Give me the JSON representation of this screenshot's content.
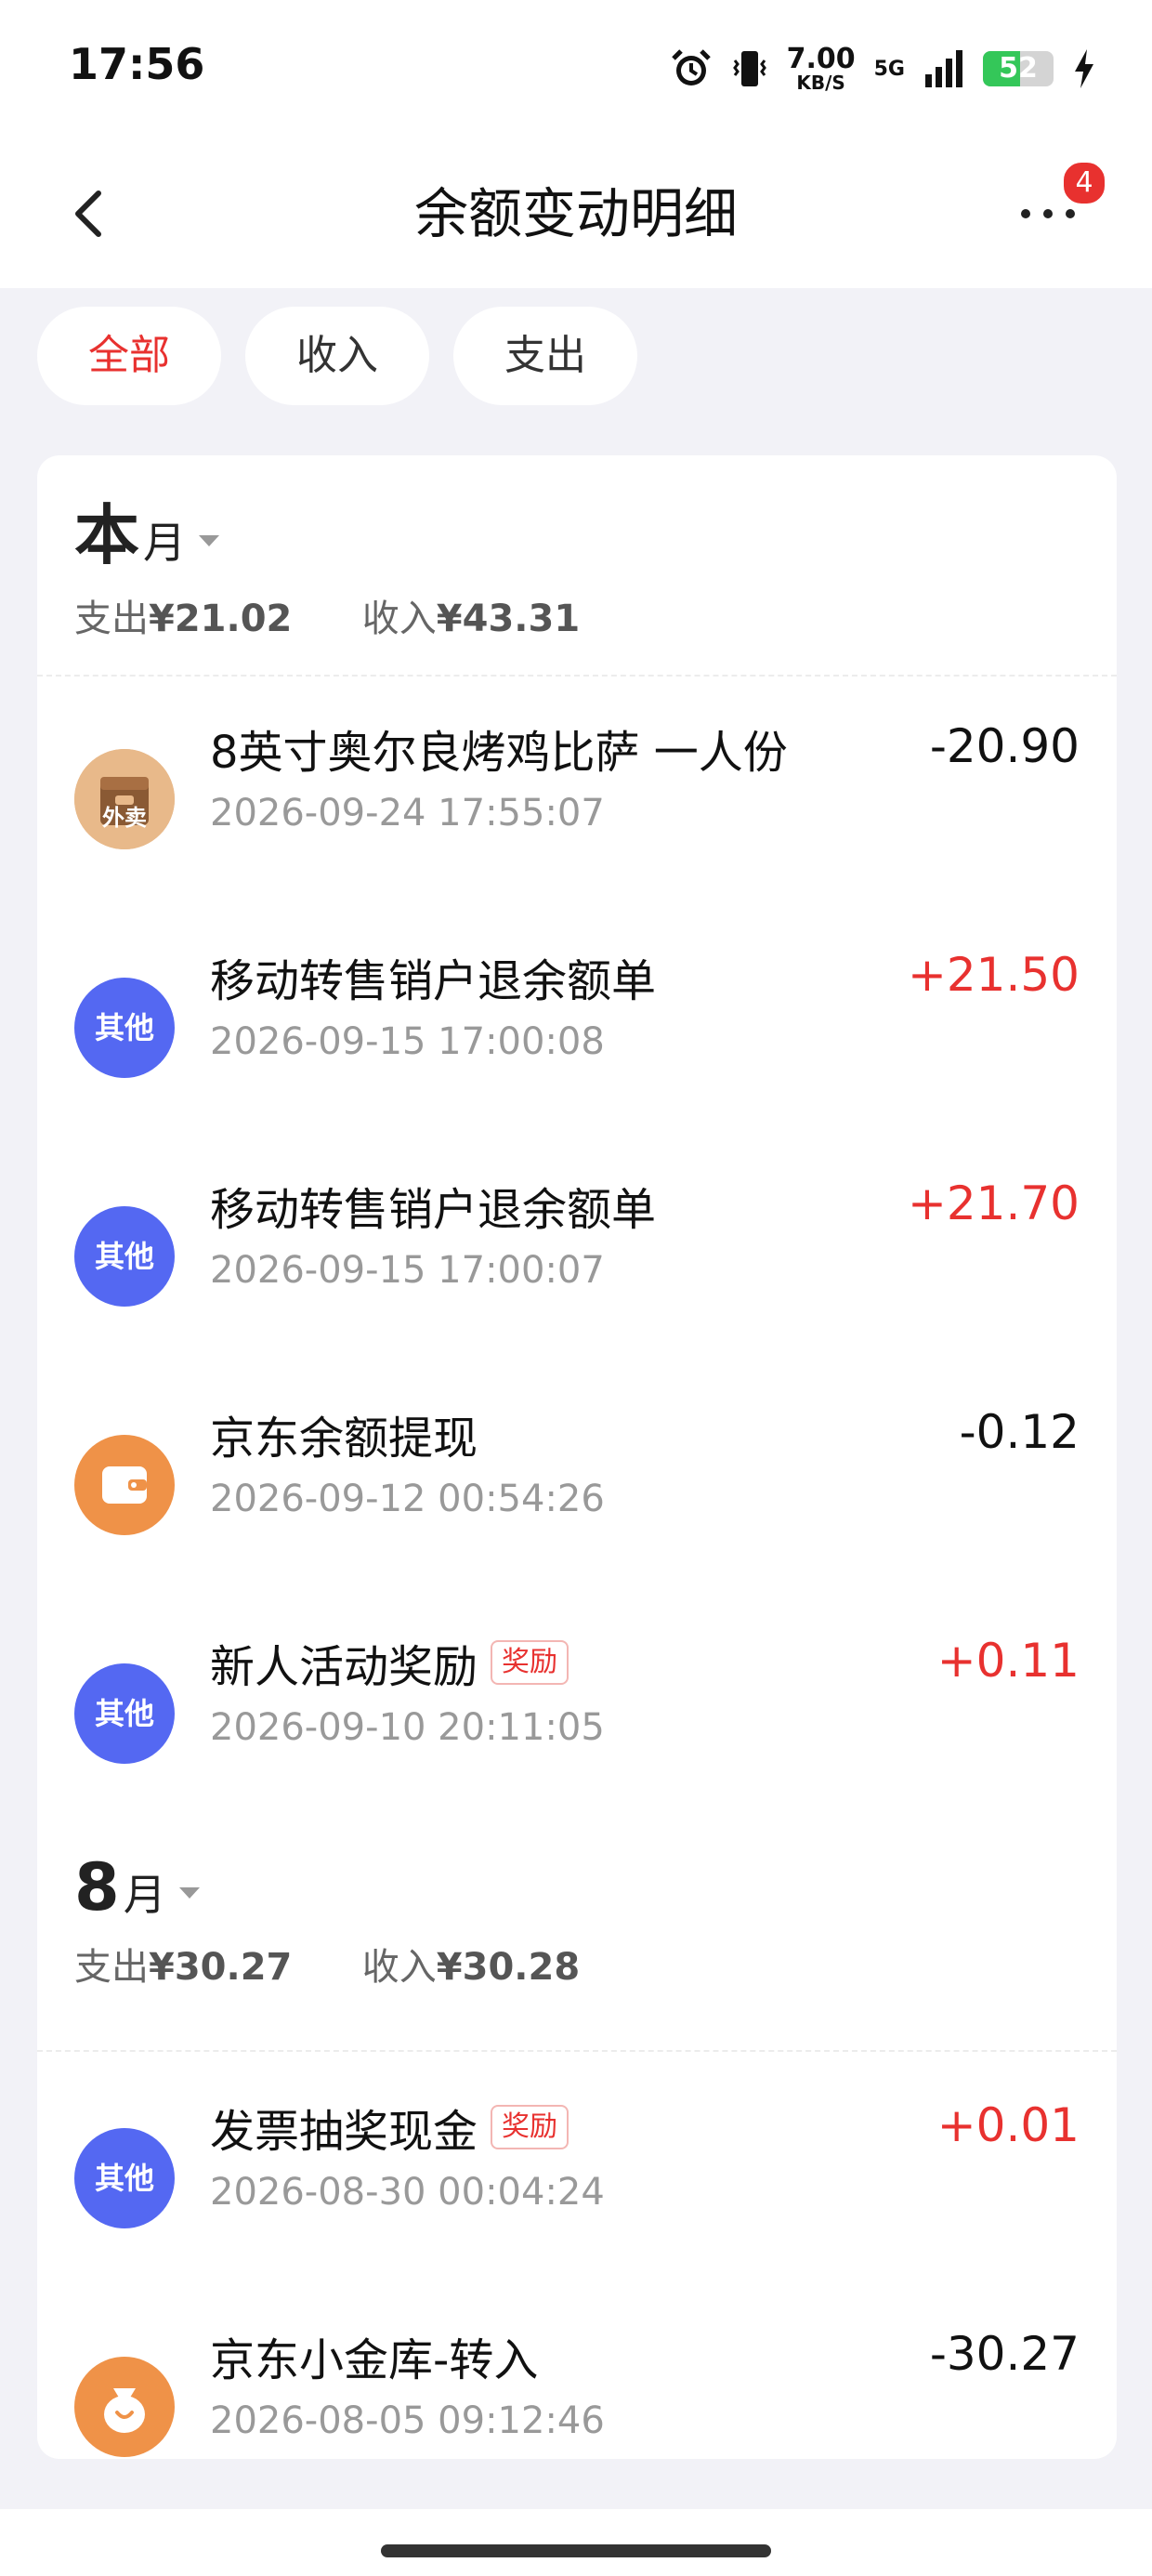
{
  "status": {
    "time": "17:56",
    "speed_value": "7.00",
    "speed_unit": "KB/S",
    "network": "5G",
    "battery": "52",
    "battery_level": 0.52
  },
  "nav": {
    "title": "余额变动明细",
    "badge": "4"
  },
  "tabs": [
    {
      "label": "全部",
      "active": true
    },
    {
      "label": "收入",
      "active": false
    },
    {
      "label": "支出",
      "active": false
    }
  ],
  "months": [
    {
      "title": "本",
      "unit": "月",
      "expense_label": "支出",
      "expense": "¥21.02",
      "income_label": "收入",
      "income": "¥43.31"
    },
    {
      "title": "8",
      "unit": "月",
      "expense_label": "支出",
      "expense": "¥30.27",
      "income_label": "收入",
      "income": "¥30.28"
    }
  ],
  "transactions": [
    {
      "avatar": "外卖",
      "icon": "takeout-bag-icon",
      "title": "8英寸奥尔良烤鸡比萨 一人份",
      "tag": "",
      "time": "2026-09-24 17:55:07",
      "amount": "-20.90"
    },
    {
      "avatar": "其他",
      "icon": "other-icon",
      "title": "移动转售销户退余额单",
      "tag": "",
      "time": "2026-09-15 17:00:08",
      "amount": "+21.50"
    },
    {
      "avatar": "其他",
      "icon": "other-icon",
      "title": "移动转售销户退余额单",
      "tag": "",
      "time": "2026-09-15 17:00:07",
      "amount": "+21.70"
    },
    {
      "avatar": "",
      "icon": "wallet-icon",
      "title": "京东余额提现",
      "tag": "",
      "time": "2026-09-12 00:54:26",
      "amount": "-0.12"
    },
    {
      "avatar": "其他",
      "icon": "other-icon",
      "title": "新人活动奖励",
      "tag": "奖励",
      "time": "2026-09-10 20:11:05",
      "amount": "+0.11"
    },
    {
      "avatar": "其他",
      "icon": "other-icon",
      "title": "发票抽奖现金",
      "tag": "奖励",
      "time": "2026-08-30 00:04:24",
      "amount": "+0.01"
    },
    {
      "avatar": "",
      "icon": "money-bag-icon",
      "title": "京东小金库-转入",
      "tag": "",
      "time": "2026-08-05 09:12:46",
      "amount": "-30.27"
    }
  ],
  "colors": {
    "accent": "#e8312f",
    "other_avatar": "#5468f2",
    "orange_avatar": "#ef9248"
  }
}
